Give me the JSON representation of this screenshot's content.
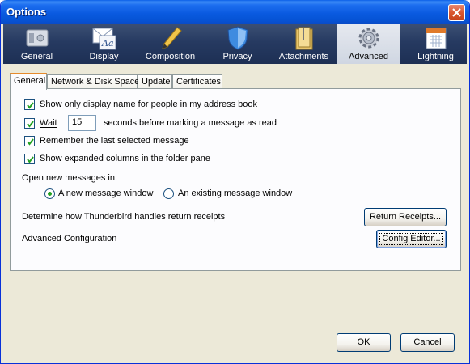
{
  "window": {
    "title": "Options"
  },
  "panes": [
    {
      "label": "General",
      "icon": "general-icon"
    },
    {
      "label": "Display",
      "icon": "display-icon"
    },
    {
      "label": "Composition",
      "icon": "composition-icon"
    },
    {
      "label": "Privacy",
      "icon": "privacy-icon"
    },
    {
      "label": "Attachments",
      "icon": "attachments-icon"
    },
    {
      "label": "Advanced",
      "icon": "advanced-icon",
      "selected": true
    },
    {
      "label": "Lightning",
      "icon": "lightning-icon"
    }
  ],
  "tabs": [
    {
      "label": "General",
      "active": true
    },
    {
      "label": "Network & Disk Space"
    },
    {
      "label": "Update"
    },
    {
      "label": "Certificates"
    }
  ],
  "general": {
    "show_display_name": {
      "label": "Show only display name for people in my address book",
      "checked": true
    },
    "wait": {
      "label": "Wait",
      "checked": true,
      "value": "15",
      "suffix": "seconds before marking a message as read"
    },
    "remember_last": {
      "label": "Remember the last selected message",
      "checked": true
    },
    "expanded_columns": {
      "label": "Show expanded columns in the folder pane",
      "checked": true
    },
    "open_new_messages_label": "Open new messages in:",
    "open_options": [
      {
        "label": "A new message window",
        "selected": true
      },
      {
        "label": "An existing message window",
        "selected": false
      }
    ],
    "return_receipts_text": "Determine how Thunderbird handles return receipts",
    "return_receipts_button": "Return Receipts...",
    "advanced_config_text": "Advanced Configuration",
    "config_editor_button": "Config Editor..."
  },
  "footer": {
    "ok": "OK",
    "cancel": "Cancel"
  }
}
